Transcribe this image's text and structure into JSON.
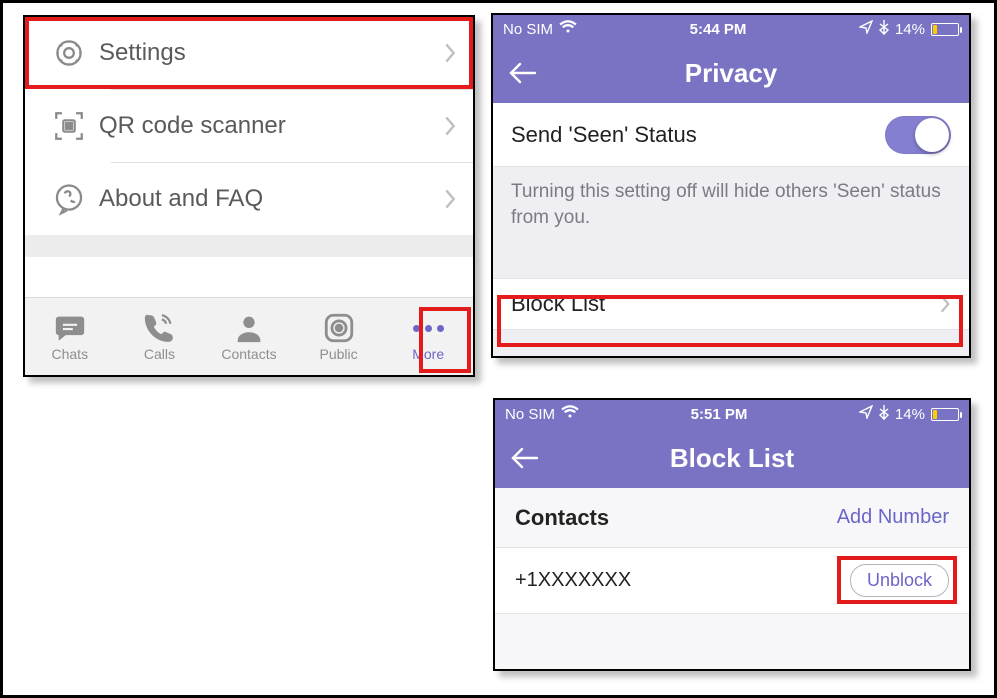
{
  "panel1": {
    "rows": [
      {
        "label": "Settings"
      },
      {
        "label": "QR code scanner"
      },
      {
        "label": "About and FAQ"
      }
    ],
    "tabs": {
      "chats": "Chats",
      "calls": "Calls",
      "contacts": "Contacts",
      "public": "Public",
      "more": "More"
    }
  },
  "panel2": {
    "status": {
      "carrier": "No SIM",
      "time": "5:44 PM",
      "battery": "14%"
    },
    "title": "Privacy",
    "seen_label": "Send 'Seen' Status",
    "seen_hint": "Turning this setting off will hide others 'Seen' status from you.",
    "blocklist_label": "Block List"
  },
  "panel3": {
    "status": {
      "carrier": "No SIM",
      "time": "5:51 PM",
      "battery": "14%"
    },
    "title": "Block List",
    "section_title": "Contacts",
    "add_label": "Add Number",
    "entries": [
      {
        "number": "+1XXXXXXX",
        "action": "Unblock"
      }
    ]
  }
}
